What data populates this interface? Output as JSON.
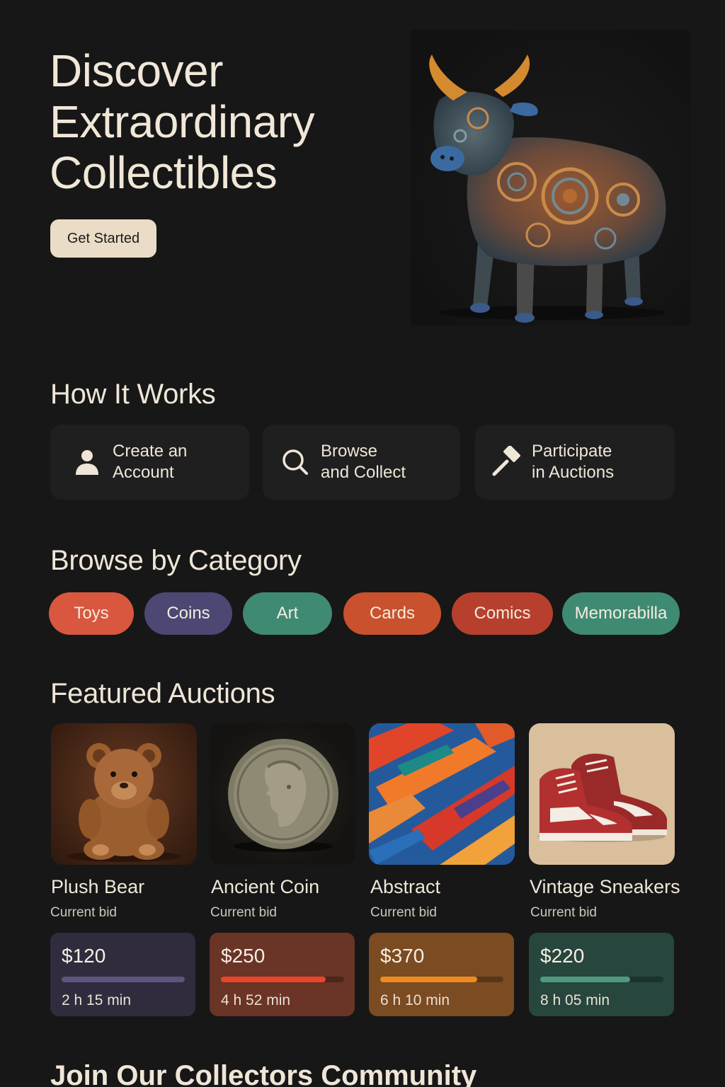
{
  "hero": {
    "title_lines": [
      "Discover",
      "Extraordinary",
      "Collectibles"
    ],
    "cta_label": "Get Started",
    "image_icon": "patterned-bull-figurine-image"
  },
  "how_it_works": {
    "title": "How It Works",
    "steps": [
      {
        "line1": "Create an",
        "line2": "Account",
        "icon": "user-icon"
      },
      {
        "line1": "Browse",
        "line2": "and Collect",
        "icon": "search-icon"
      },
      {
        "line1": "Participate",
        "line2": "in Auctions",
        "icon": "gavel-icon"
      }
    ]
  },
  "categories": {
    "title": "Browse by Category",
    "items": [
      {
        "label": "Toys",
        "color": "#d9573f"
      },
      {
        "label": "Coins",
        "color": "#4d4773"
      },
      {
        "label": "Art",
        "color": "#3f8a72"
      },
      {
        "label": "Cards",
        "color": "#c9512d"
      },
      {
        "label": "Comics",
        "color": "#b6402d"
      },
      {
        "label": "Memorabilla",
        "color": "#3f8a72"
      }
    ]
  },
  "featured": {
    "title": "Featured Auctions",
    "items": [
      {
        "name": "Plush Bear",
        "sub": "Current bid",
        "price": "$120",
        "time": "2 h  15 min",
        "progress": 1.0,
        "box_color": "#302c3d",
        "bar_color": "#5d557f",
        "image": "teddy-bear-image"
      },
      {
        "name": "Ancient Coin",
        "sub": "Current bid",
        "price": "$250",
        "time": "4 h 52 min",
        "progress": 0.85,
        "box_color": "#6a3426",
        "bar_color": "#e9452a",
        "image": "ancient-coin-image"
      },
      {
        "name": "Abstract",
        "sub": "Current bid",
        "price": "$370",
        "time": "6 h  10 min",
        "progress": 0.79,
        "box_color": "#7b4b22",
        "bar_color": "#ee8a1f",
        "image": "abstract-painting-image"
      },
      {
        "name": "Vintage Sneakers",
        "sub": "Current bid",
        "price": "$220",
        "time": "8 h 05 min",
        "progress": 0.73,
        "box_color": "#27463d",
        "bar_color": "#4e9a80",
        "image": "red-sneakers-image"
      }
    ]
  },
  "community": {
    "title": "Join Our Collectors Community"
  }
}
